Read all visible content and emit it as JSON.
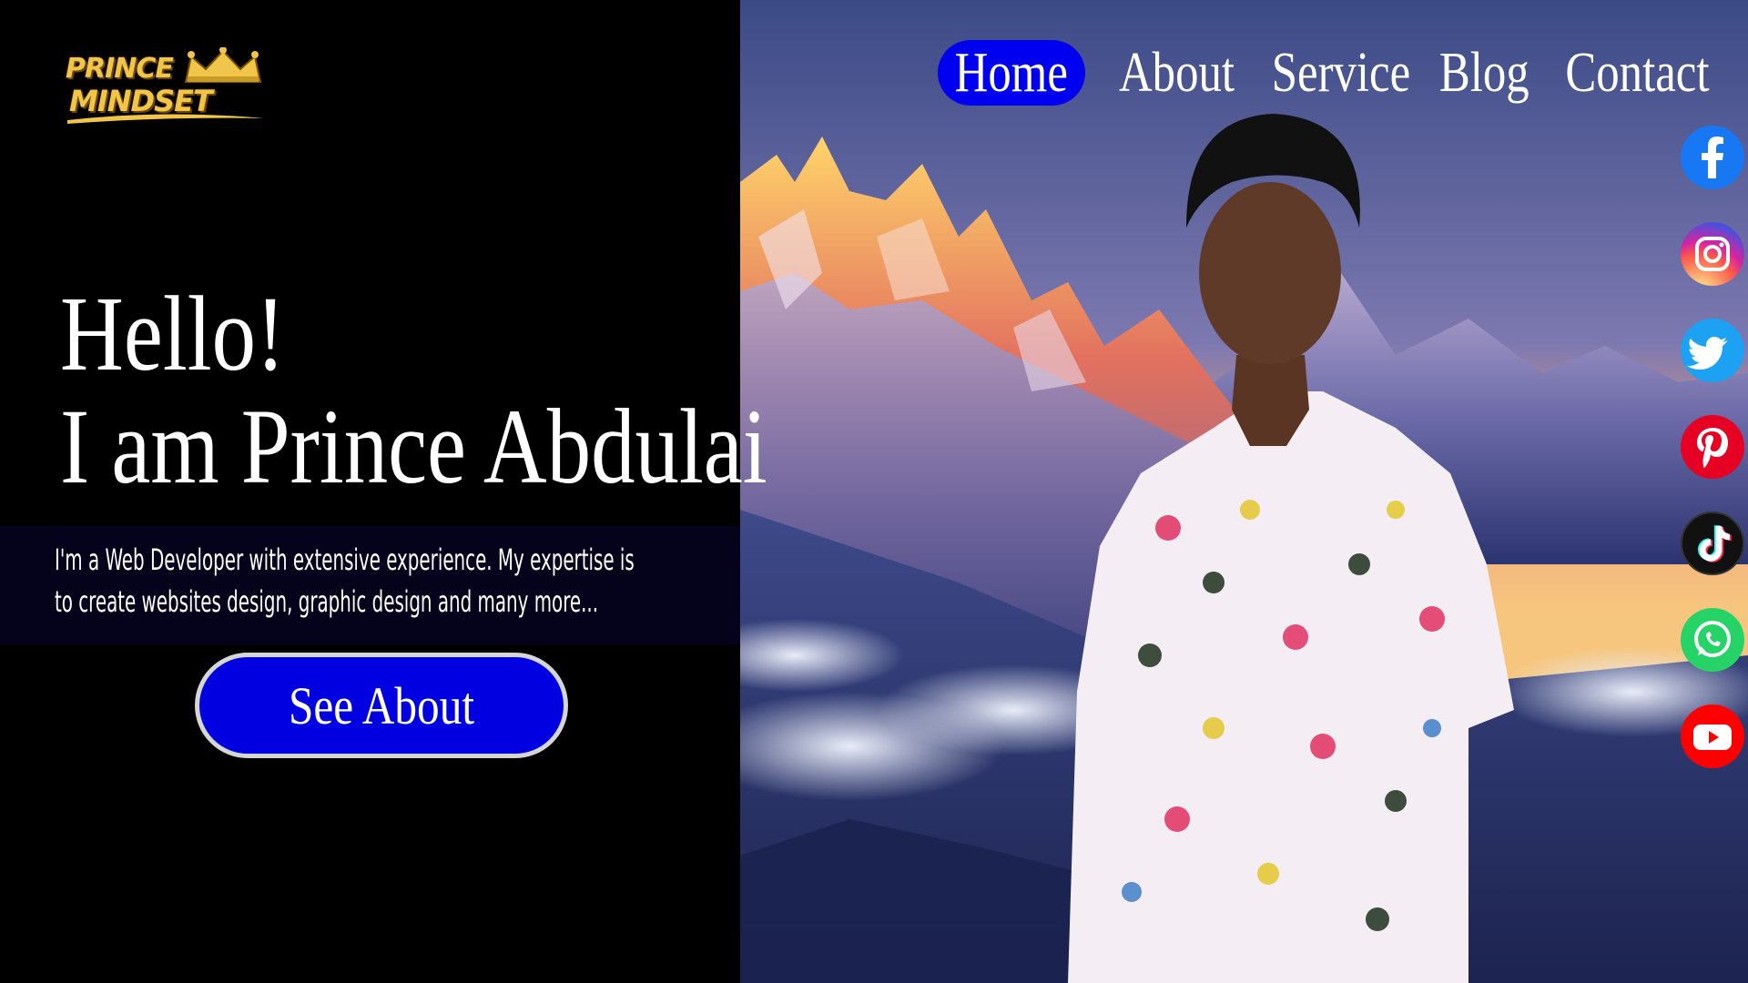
{
  "brand": {
    "logo_line1": "PRINCE",
    "logo_line2": "MINDSET"
  },
  "nav": {
    "items": [
      {
        "label": "Home",
        "active": true
      },
      {
        "label": "About",
        "active": false
      },
      {
        "label": "Service",
        "active": false
      },
      {
        "label": "Blog",
        "active": false
      },
      {
        "label": "Contact",
        "active": false
      }
    ]
  },
  "hero": {
    "greeting": "Hello!",
    "intro": "I am Prince Abdulai",
    "description": "I'm a Web Developer with extensive experience. My expertise is to create websites design, graphic design and many more...",
    "cta_label": "See About"
  },
  "social": [
    {
      "icon": "facebook-icon",
      "color": "#1877f2"
    },
    {
      "icon": "instagram-icon",
      "color": "#d6249f"
    },
    {
      "icon": "twitter-icon",
      "color": "#1da1f2"
    },
    {
      "icon": "pinterest-icon",
      "color": "#e60023"
    },
    {
      "icon": "tiktok-icon",
      "color": "#111111"
    },
    {
      "icon": "whatsapp-icon",
      "color": "#25d366"
    },
    {
      "icon": "youtube-icon",
      "color": "#ff0000"
    }
  ],
  "colors": {
    "accent": "#0000f0",
    "cta_border": "#d6d6d6",
    "logo_gold": "#f1c54a",
    "left_bg": "#000000",
    "desc_band": "#05031c"
  }
}
